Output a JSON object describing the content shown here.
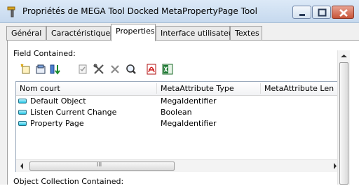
{
  "window": {
    "title": "Propriétés de MEGA Tool Docked MetaPropertyPage Tool"
  },
  "tabs": [
    {
      "label": "Général"
    },
    {
      "label": "Caractéristiques"
    },
    {
      "label": "Properties"
    },
    {
      "label": "Interface utilisateur"
    },
    {
      "label": "Textes"
    }
  ],
  "active_tab": "Properties",
  "field_contained": {
    "label": "Field Contained:",
    "toolbar_icons": [
      "new-icon",
      "connect-icon",
      "reorder-icon",
      "check-icon",
      "tools-icon",
      "delete-icon",
      "find-icon",
      "pdf-icon",
      "excel-icon"
    ],
    "columns": [
      "Nom court",
      "MetaAttribute Type",
      "MetaAttribute Len"
    ],
    "rows": [
      {
        "name": "Default Object",
        "type": "MegaIdentifier"
      },
      {
        "name": "Listen Current Change",
        "type": "Boolean"
      },
      {
        "name": "Property Page",
        "type": "MegaIdentifier"
      }
    ],
    "scroll_grip": "III"
  },
  "object_collection": {
    "label": "Object Collection Contained:"
  }
}
